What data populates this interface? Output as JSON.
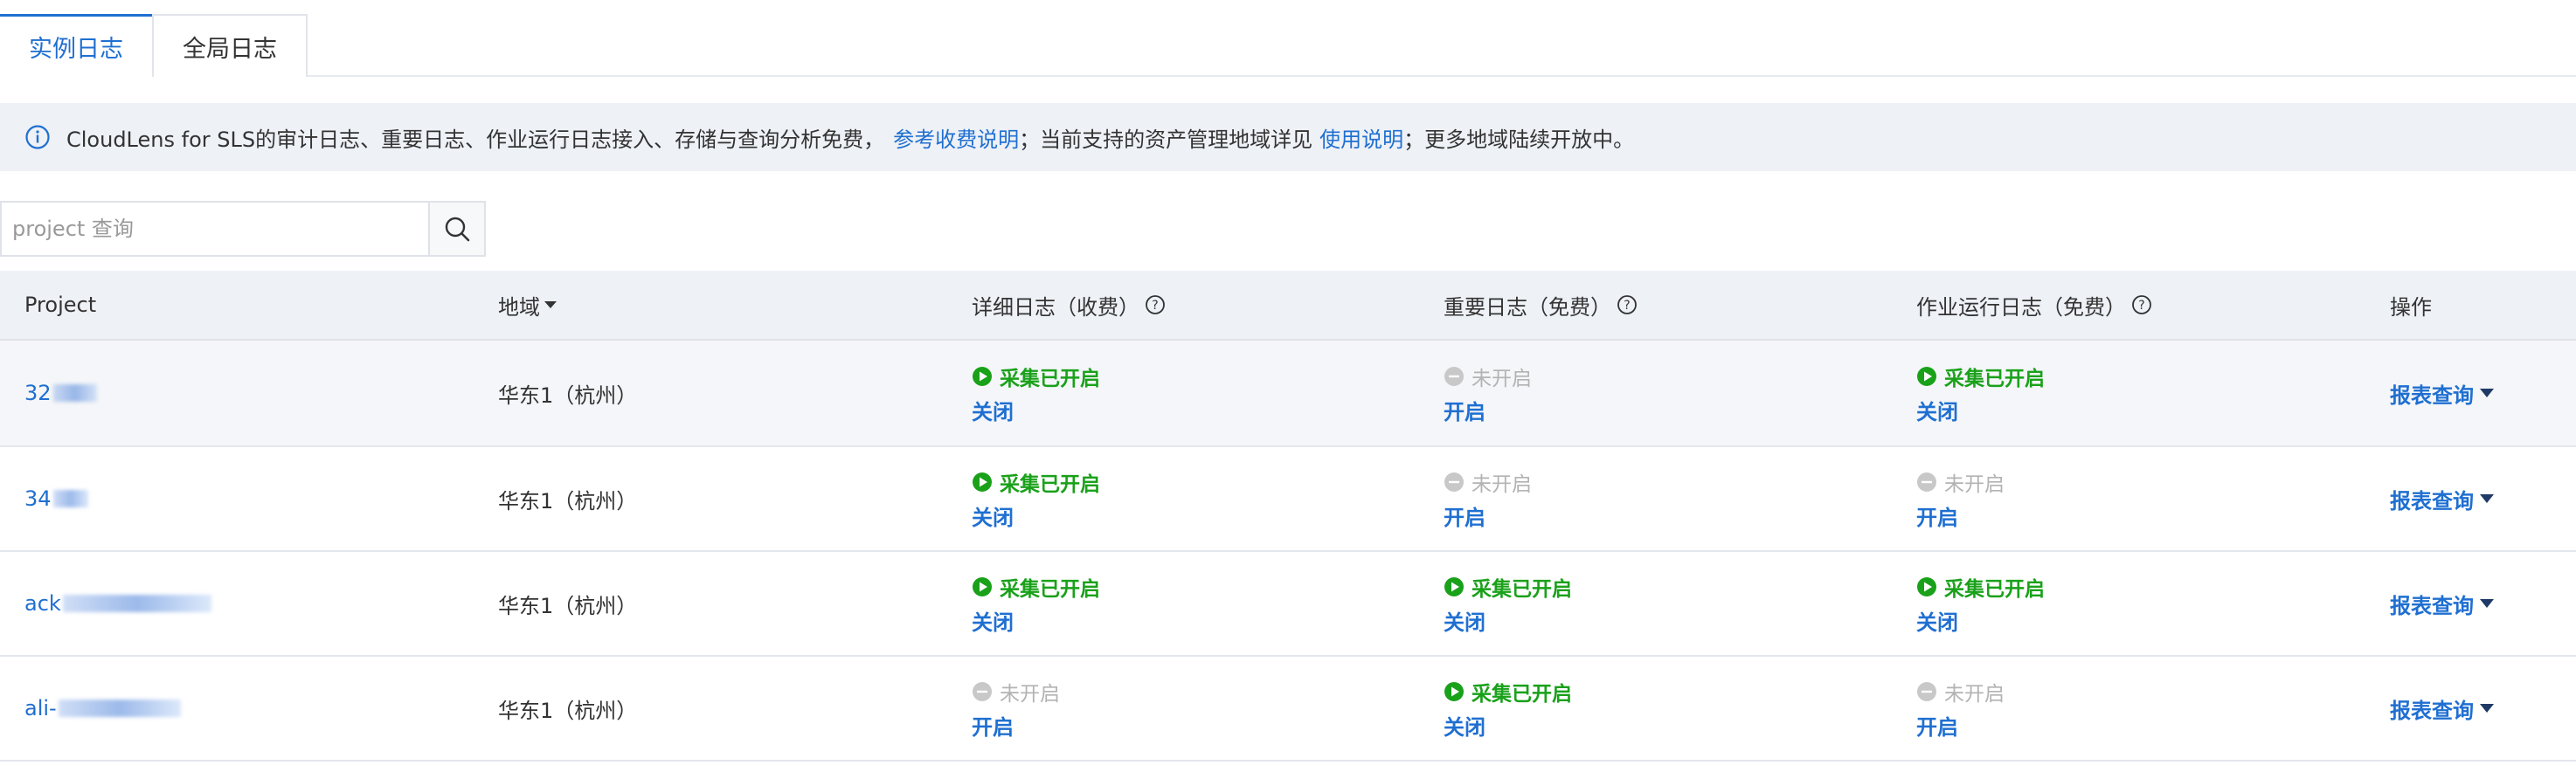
{
  "tabs": [
    {
      "label": "实例日志",
      "active": true
    },
    {
      "label": "全局日志",
      "active": false
    }
  ],
  "banner": {
    "icon": "info-icon",
    "text1": "CloudLens for SLS的审计日志、重要日志、作业运行日志接入、存储与查询分析免费，",
    "link1": "参考收费说明",
    "text2": "；当前支持的资产管理地域详见",
    "link2": "使用说明",
    "text3": "；更多地域陆续开放中。"
  },
  "search": {
    "placeholder": "project 查询",
    "icon": "search-icon"
  },
  "table": {
    "headers": {
      "project": "Project",
      "region": "地域",
      "detail": "详细日志（收费）",
      "important": "重要日志（免费）",
      "job": "作业运行日志（免费）",
      "ops": "操作"
    },
    "rows": [
      {
        "project": "32",
        "region": "华东1（杭州）",
        "detail": {
          "status": "采集已开启",
          "on": true,
          "action": "关闭"
        },
        "important": {
          "status": "未开启",
          "on": false,
          "action": "开启"
        },
        "job": {
          "status": "采集已开启",
          "on": true,
          "action": "关闭"
        },
        "op": "报表查询"
      },
      {
        "project": "34",
        "region": "华东1（杭州）",
        "detail": {
          "status": "采集已开启",
          "on": true,
          "action": "关闭"
        },
        "important": {
          "status": "未开启",
          "on": false,
          "action": "开启"
        },
        "job": {
          "status": "未开启",
          "on": false,
          "action": "开启"
        },
        "op": "报表查询"
      },
      {
        "project": "ack",
        "region": "华东1（杭州）",
        "detail": {
          "status": "采集已开启",
          "on": true,
          "action": "关闭"
        },
        "important": {
          "status": "采集已开启",
          "on": true,
          "action": "关闭"
        },
        "job": {
          "status": "采集已开启",
          "on": true,
          "action": "关闭"
        },
        "op": "报表查询"
      },
      {
        "project": "ali-",
        "region": "华东1（杭州）",
        "detail": {
          "status": "未开启",
          "on": false,
          "action": "开启"
        },
        "important": {
          "status": "采集已开启",
          "on": true,
          "action": "关闭"
        },
        "job": {
          "status": "未开启",
          "on": false,
          "action": "开启"
        },
        "op": "报表查询"
      }
    ]
  },
  "colors": {
    "accent": "#1f6fd1",
    "on": "#1aa11a",
    "off": "#b3b3b3",
    "header_bg": "#eef1f6"
  }
}
